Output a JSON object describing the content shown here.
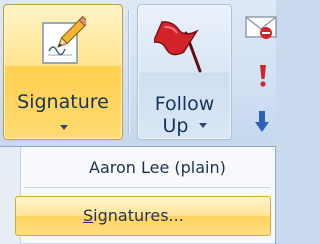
{
  "ribbon": {
    "signature_button": {
      "label": "Signature",
      "icon": "signature-pen-icon",
      "has_dropdown": true
    },
    "follow_up_button": {
      "label_line1": "Follow",
      "label_line2": "Up",
      "icon": "red-flag-icon",
      "has_dropdown": true
    },
    "partial_group_icons": [
      "envelope-icon",
      "high-importance-icon",
      "low-importance-icon"
    ]
  },
  "menu": {
    "items": [
      {
        "label": "Aaron Lee (plain)"
      },
      {
        "label_prefix": "",
        "label_accel": "S",
        "label_rest": "ignatures...",
        "highlighted": true
      }
    ]
  },
  "colors": {
    "hover_gold": "#ffd04f",
    "ribbon_blue": "#d2e1f3",
    "text_navy": "#15345c",
    "flag_red": "#d2232a",
    "arrow_blue": "#2d63b8"
  }
}
